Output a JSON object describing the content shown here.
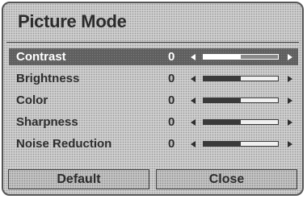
{
  "dialog": {
    "title": "Picture Mode",
    "settings": [
      {
        "label": "Contrast",
        "value": "0",
        "level": 0.5,
        "selected": true
      },
      {
        "label": "Brightness",
        "value": "0",
        "level": 0.5,
        "selected": false
      },
      {
        "label": "Color",
        "value": "0",
        "level": 0.5,
        "selected": false
      },
      {
        "label": "Sharpness",
        "value": "0",
        "level": 0.5,
        "selected": false
      },
      {
        "label": "Noise Reduction",
        "value": "0",
        "level": 0.5,
        "selected": false
      }
    ],
    "buttons": {
      "default_label": "Default",
      "close_label": "Close"
    }
  },
  "colors": {
    "panel_background": "#cfcfcf",
    "selected_row_background": "#5f5f5f",
    "text": "#2e2e2e",
    "selected_text": "#ffffff"
  },
  "icons": {
    "decrease": "left-arrow-icon",
    "increase": "right-arrow-icon"
  }
}
